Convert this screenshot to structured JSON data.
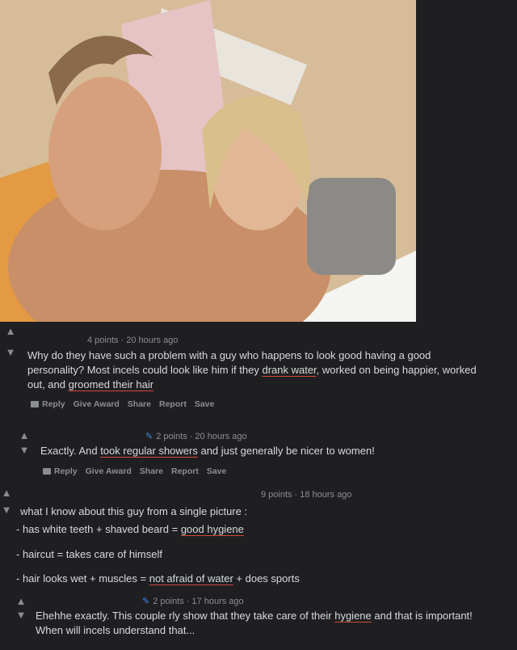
{
  "comments": [
    {
      "points": "4 points",
      "time": "20 hours ago",
      "body_parts": [
        "Why do they have such a problem with a guy who happens to look good having a good",
        "personality? Most incels could look like him if they ",
        "drank water",
        ", worked on being happier, worked",
        "out, and ",
        "groomed their hair"
      ],
      "actions": [
        "Reply",
        "Give Award",
        "Share",
        "Report",
        "Save"
      ]
    },
    {
      "points": "2 points",
      "time": "20 hours ago",
      "body_parts": [
        "Exactly. And ",
        "took regular showers",
        " and just generally be nicer to women!"
      ],
      "actions": [
        "Reply",
        "Give Award",
        "Share",
        "Report",
        "Save"
      ]
    },
    {
      "points": "9 points",
      "time": "18 hours ago",
      "lines": [
        "what I know about this guy from a single picture :",
        "- has white teeth + shaved beard = ",
        "good hygiene",
        "- haircut = takes care of himself",
        "- hair looks wet + muscles = ",
        "not afraid of water",
        " + does sports"
      ]
    },
    {
      "points": "2 points",
      "time": "17 hours ago",
      "body_parts": [
        "Ehehhe exactly. This couple rly show that they take care of their ",
        "hygiene",
        " and that is important!",
        "When will incels understand that..."
      ]
    }
  ],
  "separator": "·",
  "icons": {
    "upvote": "up-arrow-icon",
    "downvote": "down-arrow-icon",
    "flair": "pen-icon",
    "reply": "comment-bubble-icon"
  },
  "colors": {
    "background": "#1f1f21",
    "text": "#d7dadc",
    "meta": "#8b8e90",
    "flair": "#3a8de0",
    "spellcheck_underline": "#d24a3a"
  }
}
